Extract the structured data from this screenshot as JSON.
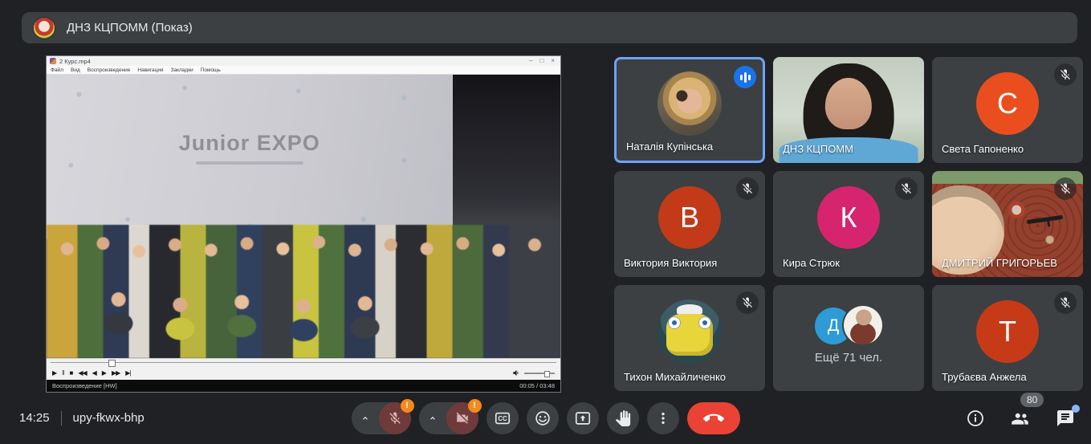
{
  "top_bar": {
    "title": "ДНЗ КЦПОММ (Показ)"
  },
  "player": {
    "window_title": "2 Курс.mp4",
    "menu": [
      "Файл",
      "Вид",
      "Воспроизведение",
      "Навигация",
      "Закладки",
      "Помощь"
    ],
    "window_buttons": [
      "–",
      "□",
      "×"
    ],
    "banner_title": "Junior EXPO",
    "transport": [
      "▶",
      "‖",
      "■",
      "◀◀",
      "◀",
      "▶",
      "▶▶",
      "▶|"
    ],
    "status_left": "Воспроизведение [HW]",
    "status_time": "00:05 / 03:48"
  },
  "participants": [
    {
      "name": "Наталія Купінська",
      "type": "photo-avatar",
      "speaking": true,
      "muted": false
    },
    {
      "name": "ДНЗ КЦПОММ",
      "type": "video",
      "muted": false
    },
    {
      "name": "Света Гапоненко",
      "type": "initial",
      "initial": "С",
      "avatar_color": "#ea4e1e",
      "muted": true
    },
    {
      "name": "Виктория Виктория",
      "type": "initial",
      "initial": "В",
      "avatar_color": "#c23a17",
      "muted": true
    },
    {
      "name": "Кира Стрюк",
      "type": "initial",
      "initial": "К",
      "avatar_color": "#d6246e",
      "muted": true
    },
    {
      "name": "ДМИТРИЙ ГРИГОРЬЕВ",
      "type": "video",
      "muted": true
    },
    {
      "name": "Тихон Михайличенко",
      "type": "photo-avatar",
      "muted": true
    },
    {
      "name": "Ещё 71 чел.",
      "type": "overflow",
      "overflow_initial": "Д",
      "muted": false
    },
    {
      "name": "Трубаєва Анжела",
      "type": "initial",
      "initial": "Т",
      "avatar_color": "#c73a17",
      "muted": true
    }
  ],
  "bottom_bar": {
    "time": "14:25",
    "meeting_code": "upy-fkwx-bhp",
    "mic_alert": "!",
    "cam_alert": "!",
    "chat_badge": "80"
  },
  "colors": {
    "background": "#202124",
    "tile": "#3c4043",
    "active_speaker_border": "#6fa2f6",
    "speaking_indicator": "#1a73e8",
    "muted_control": "#703a3a",
    "alert_badge": "#f5891c",
    "end_call": "#ea4335",
    "chat_dot": "#8ab4f8"
  }
}
